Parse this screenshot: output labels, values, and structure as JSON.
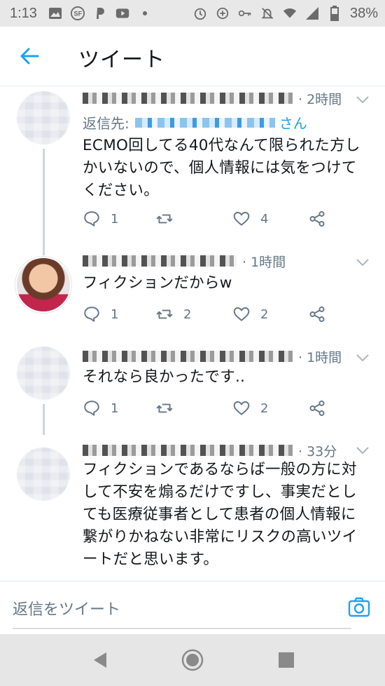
{
  "status_bar": {
    "time": "1:13",
    "battery": "38%",
    "icons_left": [
      "image-icon",
      "sf-icon",
      "p-icon",
      "youtube-icon",
      "dot-icon"
    ],
    "icons_right": [
      "alarm-icon",
      "data-saver-icon",
      "key-icon",
      "mute-icon",
      "wifi-icon",
      "signal-icon",
      "battery-icon"
    ]
  },
  "header": {
    "title": "ツイート",
    "back_icon": "arrow-left-icon"
  },
  "tweets": [
    {
      "time": "· 2時間",
      "reply_to_prefix": "返信先:",
      "reply_to_suffix": "さん",
      "text": "ECMO回してる40代なんて限られた方しかいないので、個人情報には気をつけてください。",
      "replies": "1",
      "retweets": "",
      "likes": "4"
    },
    {
      "time": "· 1時間",
      "text": "フィクションだからw",
      "replies": "1",
      "retweets": "2",
      "likes": "2"
    },
    {
      "time": "· 1時間",
      "text": "それなら良かったです..",
      "replies": "1",
      "retweets": "",
      "likes": "2"
    },
    {
      "time": "· 33分",
      "text": "フィクションであるならば一般の方に対して不安を煽るだけですし、事実だとしても医療従事者として患者の個人情報に繋がりかねない非常にリスクの高いツイートだと思います。"
    }
  ],
  "compose": {
    "placeholder": "返信をツイート",
    "camera_icon": "camera-icon"
  },
  "colors": {
    "accent": "#1da1f2",
    "muted": "#657786",
    "text": "#14171a"
  }
}
